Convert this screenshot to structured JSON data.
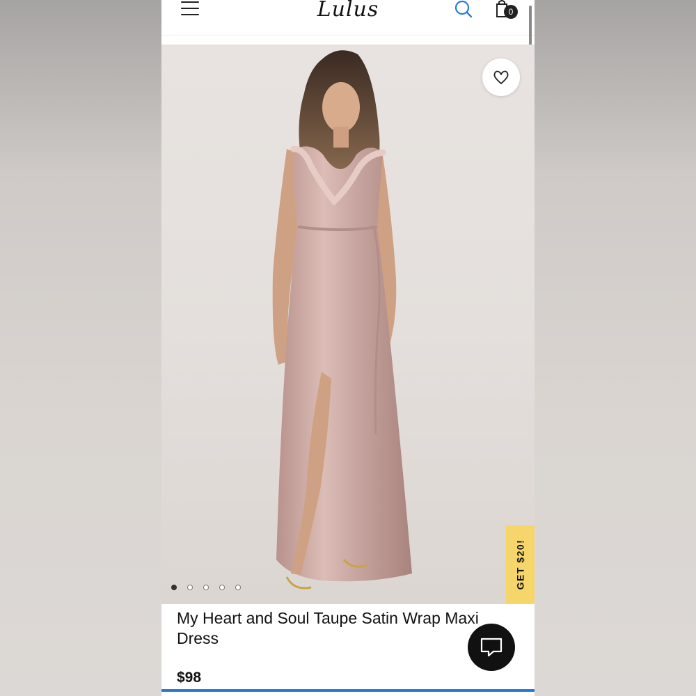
{
  "header": {
    "logo": "Lulus",
    "cart_count": "0"
  },
  "hero": {
    "favorite_icon": "heart-icon",
    "carousel": {
      "total": 5,
      "active": 1
    },
    "promo_label": "GET $20!"
  },
  "product": {
    "title": "My Heart and Soul Taupe Satin Wrap Maxi Dress",
    "price": "$98"
  },
  "colors": {
    "accent": "#2b7bd6",
    "promo": "#f6d56b",
    "dress": "#c9a7a2"
  }
}
